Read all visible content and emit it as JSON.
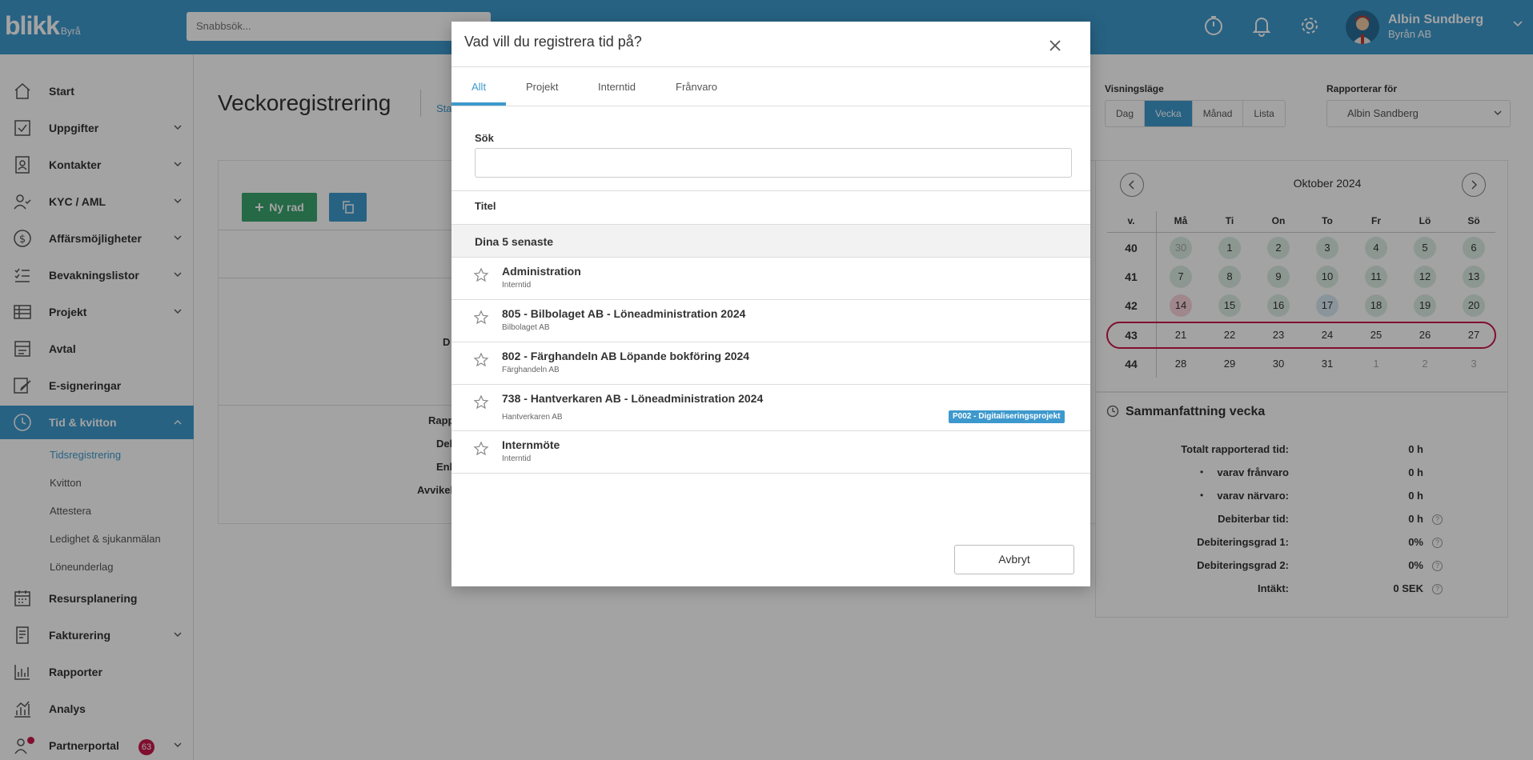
{
  "topbar": {
    "logo_main": "blikk",
    "logo_sub": "Byrå",
    "search_placeholder": "Snabbsök...",
    "user_name": "Albin Sundberg",
    "user_org": "Byrån AB",
    "icons": [
      "timer-icon",
      "bell-icon",
      "gear-icon"
    ]
  },
  "sidebar": {
    "items": [
      {
        "label": "Start",
        "icon": "home-icon",
        "chevron": false
      },
      {
        "label": "Uppgifter",
        "icon": "checkbox-icon",
        "chevron": true
      },
      {
        "label": "Kontakter",
        "icon": "contact-icon",
        "chevron": true
      },
      {
        "label": "KYC / AML",
        "icon": "user-check-icon",
        "chevron": true
      },
      {
        "label": "Affärsmöjligheter",
        "icon": "dollar-icon",
        "chevron": true
      },
      {
        "label": "Bevakningslistor",
        "icon": "list-icon",
        "chevron": true
      },
      {
        "label": "Projekt",
        "icon": "table-icon",
        "chevron": true
      },
      {
        "label": "Avtal",
        "icon": "contract-icon",
        "chevron": false
      },
      {
        "label": "E-signeringar",
        "icon": "signature-icon",
        "chevron": false
      },
      {
        "label": "Tid & kvitton",
        "icon": "clock-icon",
        "chevron": true
      }
    ],
    "sub_items": [
      "Tidsregistrering",
      "Kvitton",
      "Attestera",
      "Ledighet & sjukanmälan",
      "Löneunderlag"
    ],
    "items_bottom": [
      {
        "label": "Resursplanering",
        "icon": "calendar-icon",
        "chevron": false
      },
      {
        "label": "Fakturering",
        "icon": "invoice-icon",
        "chevron": true
      },
      {
        "label": "Rapporter",
        "icon": "bar-chart-icon",
        "chevron": false
      },
      {
        "label": "Analys",
        "icon": "analytics-icon",
        "chevron": false
      },
      {
        "label": "Partnerportal",
        "icon": "partner-icon",
        "chevron": true,
        "badge": "63"
      }
    ]
  },
  "main": {
    "page_title": "Veckoregistrering",
    "title_link": "Sta",
    "new_row_label": "Ny rad",
    "hidden_labels": [
      "D",
      "Rapp",
      "Del",
      "Enl",
      "Avvikel"
    ]
  },
  "view_controls": {
    "view_mode_label": "Visningsläge",
    "modes": [
      "Dag",
      "Vecka",
      "Månad",
      "Lista"
    ],
    "active_mode": "Vecka",
    "report_for_label": "Rapporterar för",
    "report_for_value": "Albin Sandberg"
  },
  "calendar": {
    "title": "Oktober 2024",
    "week_col_label": "v.",
    "day_headers": [
      "Må",
      "Ti",
      "On",
      "To",
      "Fr",
      "Lö",
      "Sö"
    ],
    "weeks": [
      {
        "week": "40",
        "days": [
          "30",
          "1",
          "2",
          "3",
          "4",
          "5",
          "6"
        ]
      },
      {
        "week": "41",
        "days": [
          "7",
          "8",
          "9",
          "10",
          "11",
          "12",
          "13"
        ]
      },
      {
        "week": "42",
        "days": [
          "14",
          "15",
          "16",
          "17",
          "18",
          "19",
          "20"
        ]
      },
      {
        "week": "43",
        "days": [
          "21",
          "22",
          "23",
          "24",
          "25",
          "26",
          "27"
        ]
      },
      {
        "week": "44",
        "days": [
          "28",
          "29",
          "30",
          "31",
          "1",
          "2",
          "3"
        ]
      }
    ],
    "selected_week": "43",
    "today": "14"
  },
  "summary": {
    "title": "Sammanfattning vecka",
    "rows": [
      {
        "label": "Totalt rapporterad tid:",
        "value": "0 h",
        "help": false
      },
      {
        "label": "varav frånvaro",
        "value": "0 h",
        "help": false,
        "bullet": true
      },
      {
        "label": "varav närvaro:",
        "value": "0 h",
        "help": false,
        "bullet": true
      },
      {
        "label": "Debiterbar tid:",
        "value": "0 h",
        "help": true
      },
      {
        "label": "Debiteringsgrad 1:",
        "value": "0%",
        "help": true
      },
      {
        "label": "Debiteringsgrad 2:",
        "value": "0%",
        "help": true
      },
      {
        "label": "Intäkt:",
        "value": "0 SEK",
        "help": true
      }
    ],
    "help_glyph": "?"
  },
  "modal": {
    "title": "Vad vill du registrera tid på?",
    "tabs": [
      "Allt",
      "Projekt",
      "Interntid",
      "Frånvaro"
    ],
    "active_tab": "Allt",
    "search_label": "Sök",
    "search_value": "",
    "column_title": "Titel",
    "group_label": "Dina 5 senaste",
    "items": [
      {
        "title": "Administration",
        "subtitle": "Interntid",
        "tag": ""
      },
      {
        "title": "805 - Bilbolaget AB - Löneadministration 2024",
        "subtitle": "Bilbolaget AB",
        "tag": ""
      },
      {
        "title": "802 - Färghandeln AB Löpande bokföring 2024",
        "subtitle": "Färghandeln AB",
        "tag": ""
      },
      {
        "title": "738 - Hantverkaren AB - Löneadministration 2024",
        "subtitle": "Hantverkaren AB",
        "tag": "P002 - Digitaliseringsprojekt"
      },
      {
        "title": "Internmöte",
        "subtitle": "Interntid",
        "tag": ""
      }
    ],
    "cancel_label": "Avbryt"
  },
  "colors": {
    "primary": "#3d99cd",
    "green": "#3aa46f",
    "accent_red": "#c8184a"
  }
}
